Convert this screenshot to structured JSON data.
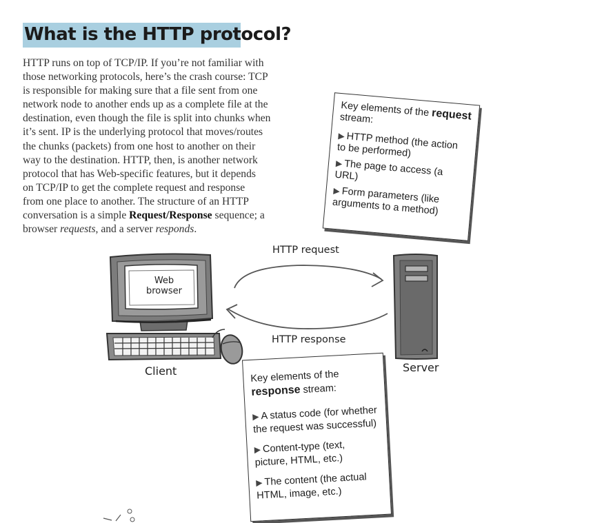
{
  "title": "What is the HTTP protocol?",
  "body_lines": [
    {
      "pre": "HTTP runs on top of TCP/IP. If you’re not familiar with"
    },
    {
      "pre": "those networking protocols, here’s the crash course: TCP"
    },
    {
      "pre": "is responsible for making sure that a file sent from one"
    },
    {
      "pre": "network node to another ends up as a complete file at the"
    },
    {
      "pre": "destination, even though the file is split into chunks when"
    },
    {
      "pre": "it’s sent. IP is the underlying protocol that moves/routes"
    },
    {
      "pre": "the chunks (packets) from one host to another on their"
    },
    {
      "pre": "way to the destination. HTTP, then, is another network"
    },
    {
      "pre": "protocol that has Web-specific features, but it depends"
    },
    {
      "pre": "on TCP/IP to get the complete request and response"
    },
    {
      "pre": "from one place to another.  The structure of an HTTP"
    },
    {
      "pre": "conversation is a simple ",
      "bold": "Request/Response",
      "post": " sequence; a"
    },
    {
      "pre": "browser ",
      "em1": "requests",
      "mid": ", and a server ",
      "em2": "responds",
      "post": "."
    }
  ],
  "request_note": {
    "header_pre": "Key elements of the ",
    "header_bold": "request",
    "header_post": " stream:",
    "items": [
      "HTTP method (the action to be performed)",
      "The page to access (a URL)",
      "Form parameters (like arguments to a method)"
    ]
  },
  "response_note": {
    "header_pre": "Key elements of the ",
    "header_bold": "response",
    "header_post": " stream:",
    "items": [
      "A status code (for whether the request was successful)",
      "Content-type (text, picture, HTML, etc.)",
      "The content (the actual HTML, image, etc.)"
    ]
  },
  "diagram": {
    "http_request": "HTTP request",
    "http_response": "HTTP response",
    "client": "Client",
    "server": "Server",
    "web_browser_line1": "Web",
    "web_browser_line2": "browser"
  }
}
